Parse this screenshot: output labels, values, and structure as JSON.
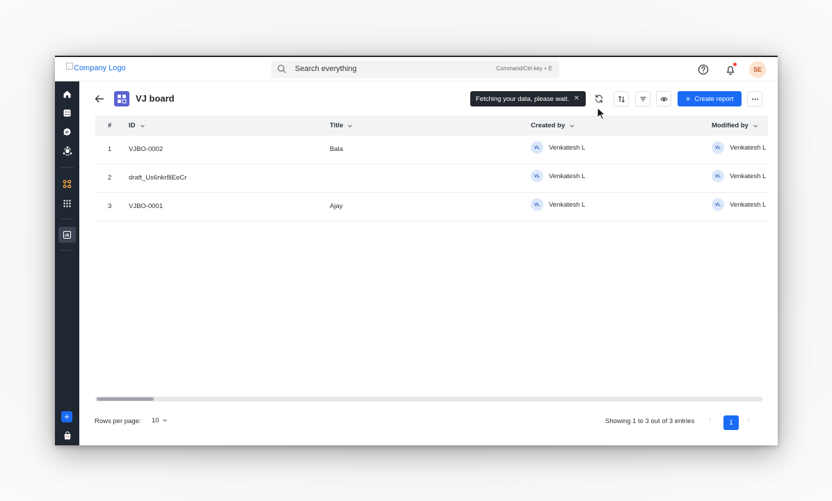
{
  "header": {
    "logo_alt": "Company Logo",
    "search_placeholder": "Search everything",
    "search_shortcut": "Command/Ctrl key + E",
    "user_initials": "SE"
  },
  "page": {
    "title": "VJ board",
    "toast_message": "Fetching your data, please wait.",
    "create_button_label": "Create report"
  },
  "table": {
    "columns": {
      "num": "#",
      "id": "ID",
      "title": "Title",
      "created_by": "Created by",
      "modified_by": "Modified by"
    },
    "rows": [
      {
        "num": "1",
        "id": "VJBO-0002",
        "title": "Bala",
        "created_initials": "VL",
        "created_by": "Venkatesh L",
        "modified_initials": "VL",
        "modified_by": "Venkatesh L"
      },
      {
        "num": "2",
        "id": "draft_Us6nkr8lEeCr",
        "title": "",
        "created_initials": "VL",
        "created_by": "Venkatesh L",
        "modified_initials": "VL",
        "modified_by": "Venkatesh L"
      },
      {
        "num": "3",
        "id": "VJBO-0001",
        "title": "Ajay",
        "created_initials": "VL",
        "created_by": "Venkatesh L",
        "modified_initials": "VL",
        "modified_by": "Venkatesh L"
      }
    ]
  },
  "footer": {
    "rows_per_page_label": "Rows per page:",
    "rows_per_page_value": "10",
    "showing_text": "Showing 1 to 3 out of 3 entries",
    "current_page": "1"
  },
  "colors": {
    "accent": "#1a6cf5",
    "sidebar_bg": "#1f2733",
    "board_icon_bg": "#5b63d3",
    "notification_dot": "#f04438"
  }
}
